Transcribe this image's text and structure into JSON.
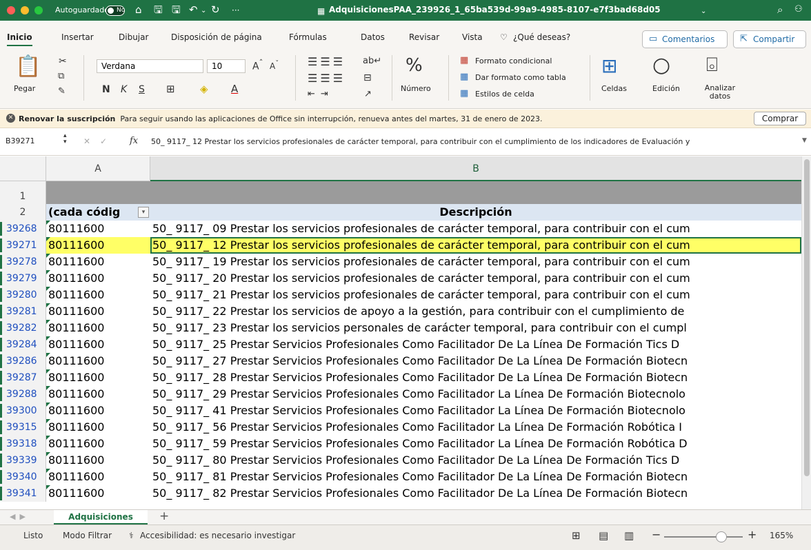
{
  "window": {
    "autosave_label": "Autoguardado",
    "autosave_state": "No",
    "title": "AdquisicionesPAA_239926_1_65ba539d-99a9-4985-8107-e7f3bad68d05"
  },
  "menu": {
    "tabs": [
      "Inicio",
      "Insertar",
      "Dibujar",
      "Disposición de página",
      "Fórmulas",
      "Datos",
      "Revisar",
      "Vista"
    ],
    "tell_me": "¿Qué deseas?",
    "comments": "Comentarios",
    "share": "Compartir"
  },
  "ribbon": {
    "paste": "Pegar",
    "font_name": "Verdana",
    "font_size": "10",
    "bold": "N",
    "italic": "K",
    "underline": "S",
    "number": "Número",
    "conditional_format": "Formato condicional",
    "format_as_table": "Dar formato como tabla",
    "cell_styles": "Estilos de celda",
    "cells": "Celdas",
    "editing": "Edición",
    "analyze_data": "Analizar datos"
  },
  "notice": {
    "title": "Renovar la suscripción",
    "message": "Para seguir usando las aplicaciones de Office sin interrupción, renueva antes del martes, 31 de enero de 2023.",
    "button": "Comprar"
  },
  "formula_bar": {
    "cell_ref": "B39271",
    "fx": "fx",
    "content": "50_ 9117_ 12 Prestar los servicios profesionales de carácter temporal, para contribuir con el cumplimiento de los indicadores de Evaluación y"
  },
  "grid": {
    "col_a": "A",
    "col_b": "B",
    "row_header_1": "1",
    "row_header_2": "2",
    "header_a": "(cada códig",
    "header_b": "Descripción",
    "rows": [
      {
        "num": "39268",
        "a": "80111600",
        "b": "50_ 9117_ 09 Prestar los servicios profesionales de carácter temporal, para contribuir con el cum"
      },
      {
        "num": "39271",
        "a": "80111600",
        "b": "50_ 9117_ 12 Prestar los servicios profesionales de carácter temporal, para contribuir con el cum"
      },
      {
        "num": "39278",
        "a": "80111600",
        "b": "50_ 9117_ 19 Prestar los servicios profesionales de carácter temporal, para contribuir con el cum"
      },
      {
        "num": "39279",
        "a": "80111600",
        "b": "50_ 9117_ 20 Prestar los servicios profesionales de carácter temporal, para contribuir con el cum"
      },
      {
        "num": "39280",
        "a": "80111600",
        "b": "50_ 9117_ 21 Prestar los servicios profesionales de carácter temporal, para contribuir con el cum"
      },
      {
        "num": "39281",
        "a": "80111600",
        "b": "50_ 9117_ 22 Prestar los servicios de apoyo a la gestión, para contribuir con el cumplimiento de"
      },
      {
        "num": "39282",
        "a": "80111600",
        "b": "50_ 9117_ 23 Prestar los servicios personales de carácter temporal, para contribuir con el cumpl"
      },
      {
        "num": "39284",
        "a": "80111600",
        "b": "50_ 9117_ 25  Prestar Servicios Profesionales Como Facilitador De La Línea  De Formación Tics D"
      },
      {
        "num": "39286",
        "a": "80111600",
        "b": "50_ 9117_ 27 Prestar Servicios Profesionales Como Facilitador De La Línea De Formación Biotecn"
      },
      {
        "num": "39287",
        "a": "80111600",
        "b": "50_ 9117_ 28 Prestar Servicios Profesionales Como Facilitador De La Línea De Formación Biotecn"
      },
      {
        "num": "39288",
        "a": "80111600",
        "b": "50_ 9117_ 29  Prestar Servicios Profesionales Como Facilitador La Línea De Formación Biotecnolo"
      },
      {
        "num": "39300",
        "a": "80111600",
        "b": "50_ 9117_ 41  Prestar Servicios Profesionales Como Facilitador La Línea De Formación Biotecnolo"
      },
      {
        "num": "39315",
        "a": "80111600",
        "b": "50_ 9117_ 56  Prestar Servicios Profesionales Como Facilitador La Línea De Formación Robótica I"
      },
      {
        "num": "39318",
        "a": "80111600",
        "b": "50_ 9117_ 59 Prestar Servicios Profesionales Como Facilitador La Línea De Formación Robótica D"
      },
      {
        "num": "39339",
        "a": "80111600",
        "b": "50_ 9117_ 80  Prestar Servicios Profesionales Como Facilitador De La Línea  De Formación Tics D"
      },
      {
        "num": "39340",
        "a": "80111600",
        "b": "50_ 9117_ 81 Prestar Servicios Profesionales Como Facilitador De La Línea De Formación Biotecn"
      },
      {
        "num": "39341",
        "a": "80111600",
        "b": "50_ 9117_ 82 Prestar Servicios Profesionales Como Facilitador De La Línea De Formación Biotecn"
      }
    ]
  },
  "sheet_tabs": {
    "active": "Adquisiciones"
  },
  "status": {
    "ready": "Listo",
    "filter_mode": "Modo Filtrar",
    "accessibility": "Accesibilidad: es necesario investigar",
    "zoom": "165%"
  },
  "colors": {
    "accent": "#1f7244",
    "selection": "#ffff66"
  }
}
